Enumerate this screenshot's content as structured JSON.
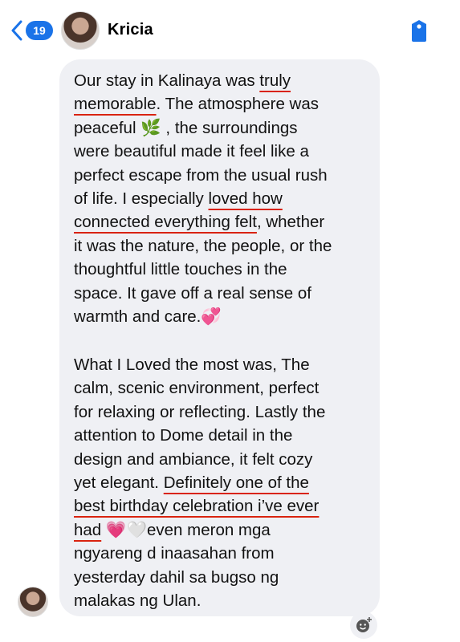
{
  "header": {
    "unread_count": "19",
    "contact_name": "Kricia"
  },
  "message": {
    "paragraph1_lines": [
      [
        "Our stay in Kalinaya was ",
        "truly"
      ],
      [
        "memorable",
        ". The atmosphere was"
      ],
      [
        "peaceful ",
        "🌿",
        " , the surroundings"
      ],
      [
        "were beautiful made it feel like a"
      ],
      [
        "perfect escape from the usual rush"
      ],
      [
        "of life. I especially ",
        "loved how"
      ],
      [
        "connected everything felt",
        ", whether"
      ],
      [
        "it was the nature, the people, or the"
      ],
      [
        "thoughtful little touches in the"
      ],
      [
        "space. It gave off a real sense of"
      ],
      [
        "warmth and care.",
        "💞"
      ]
    ],
    "paragraph2_lines": [
      [
        "What I Loved the most was, The"
      ],
      [
        "calm, scenic environment, perfect"
      ],
      [
        "for relaxing or reflecting. Lastly the"
      ],
      [
        "attention to Dome detail in the"
      ],
      [
        "design and ambiance, it felt cozy"
      ],
      [
        "yet elegant. ",
        "Definitely one of the"
      ],
      [
        "best birthday celebration i’ve ever"
      ],
      [
        "had",
        " ",
        "💗🤍",
        "even meron mga"
      ],
      [
        "ngyareng d inaasahan from"
      ],
      [
        "yesterday dahil sa bugso ng"
      ],
      [
        "malakas ng Ulan."
      ]
    ]
  },
  "icons": {
    "back": "chevron-left-icon",
    "tag": "tag-icon",
    "reaction": "add-reaction-icon"
  },
  "colors": {
    "accent": "#1a73e8",
    "bubble": "#eff0f4",
    "underline": "#d9230f"
  }
}
